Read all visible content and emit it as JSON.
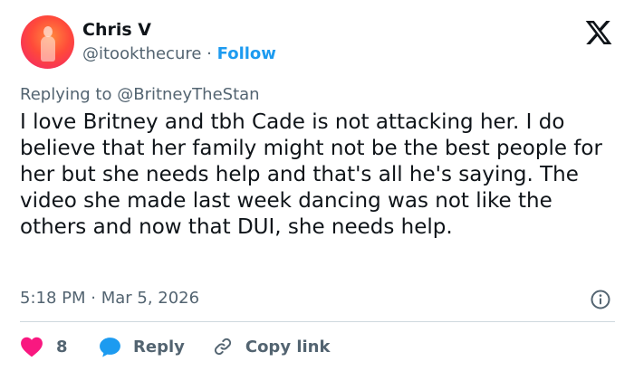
{
  "author": {
    "name": "Chris V",
    "handle": "@itookthecure",
    "separator": "·",
    "follow_label": "Follow"
  },
  "tweet": {
    "replying_prefix": "Replying to",
    "replying_to": "@BritneyTheStan",
    "text": "I love Britney and tbh Cade is not attacking her. I do believe that her family might not be the best people for her but she needs help and that's all he's saying. The video she made last week dancing was not like the others and now that DUI, she needs help.",
    "timestamp": "5:18 PM · Mar 5, 2026"
  },
  "actions": {
    "like_count": "8",
    "reply_label": "Reply",
    "copy_link_label": "Copy link"
  },
  "icons": {
    "logo": "x-logo-icon",
    "info": "info-icon",
    "like": "heart-icon",
    "reply": "reply-bubble-icon",
    "copy": "link-icon"
  },
  "colors": {
    "accent": "#1d9bf0",
    "like": "#f91880",
    "muted": "#536471",
    "text": "#0f1419",
    "divider": "#cfd9de"
  }
}
